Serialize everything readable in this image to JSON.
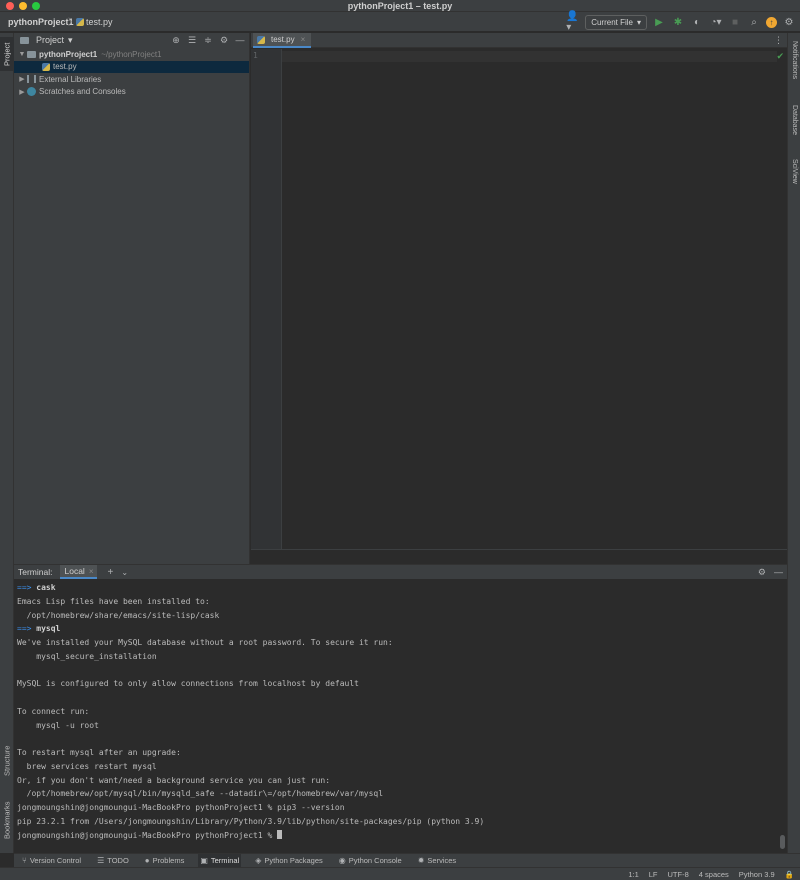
{
  "window": {
    "title": "pythonProject1 – test.py"
  },
  "navbar": {
    "project": "pythonProject1",
    "separator": "〉",
    "file": "test.py",
    "run_config": "Current File"
  },
  "left_stripe": {
    "project": "Project",
    "structure": "Structure",
    "bookmarks": "Bookmarks"
  },
  "right_stripe": {
    "notifications": "Notifications",
    "database": "Database",
    "sciview": "SciView"
  },
  "project_panel": {
    "title": "Project",
    "tree": {
      "root": {
        "name": "pythonProject1",
        "path": "~/pythonProject1"
      },
      "file": "test.py",
      "external": "External Libraries",
      "scratches": "Scratches and Consoles"
    }
  },
  "editor": {
    "tab": "test.py",
    "line_number": "1"
  },
  "terminal": {
    "title": "Terminal:",
    "tab": "Local",
    "lines": [
      {
        "type": "arrow",
        "arrow": "==>",
        "text": " cask"
      },
      {
        "type": "text",
        "text": "Emacs Lisp files have been installed to:"
      },
      {
        "type": "text",
        "text": "  /opt/homebrew/share/emacs/site-lisp/cask"
      },
      {
        "type": "arrow",
        "arrow": "==>",
        "text": " mysql"
      },
      {
        "type": "text",
        "text": "We've installed your MySQL database without a root password. To secure it run:"
      },
      {
        "type": "text",
        "text": "    mysql_secure_installation"
      },
      {
        "type": "text",
        "text": ""
      },
      {
        "type": "text",
        "text": "MySQL is configured to only allow connections from localhost by default"
      },
      {
        "type": "text",
        "text": ""
      },
      {
        "type": "text",
        "text": "To connect run:"
      },
      {
        "type": "text",
        "text": "    mysql -u root"
      },
      {
        "type": "text",
        "text": ""
      },
      {
        "type": "text",
        "text": "To restart mysql after an upgrade:"
      },
      {
        "type": "text",
        "text": "  brew services restart mysql"
      },
      {
        "type": "text",
        "text": "Or, if you don't want/need a background service you can just run:"
      },
      {
        "type": "text",
        "text": "  /opt/homebrew/opt/mysql/bin/mysqld_safe --datadir\\=/opt/homebrew/var/mysql"
      },
      {
        "type": "text",
        "text": "jongmoungshin@jongmoungui-MacBookPro pythonProject1 % pip3 --version"
      },
      {
        "type": "text",
        "text": "pip 23.2.1 from /Users/jongmoungshin/Library/Python/3.9/lib/python/site-packages/pip (python 3.9)"
      },
      {
        "type": "prompt",
        "text": "jongmoungshin@jongmoungui-MacBookPro pythonProject1 % "
      }
    ]
  },
  "tool_windows": [
    {
      "id": "version-control",
      "label": "Version Control",
      "icon": "branch-icon",
      "glyph": "⑂"
    },
    {
      "id": "todo",
      "label": "TODO",
      "icon": "list-icon",
      "glyph": "☰"
    },
    {
      "id": "problems",
      "label": "Problems",
      "icon": "info-icon",
      "glyph": "●"
    },
    {
      "id": "terminal",
      "label": "Terminal",
      "icon": "terminal-icon",
      "glyph": "▣",
      "active": true
    },
    {
      "id": "python-packages",
      "label": "Python Packages",
      "icon": "packages-icon",
      "glyph": "◈"
    },
    {
      "id": "python-console",
      "label": "Python Console",
      "icon": "console-icon",
      "glyph": "◉"
    },
    {
      "id": "services",
      "label": "Services",
      "icon": "services-icon",
      "glyph": "✹"
    }
  ],
  "status": {
    "position": "1:1",
    "line_ending": "LF",
    "encoding": "UTF-8",
    "indent": "4 spaces",
    "interpreter": "Python 3.9"
  },
  "colors": {
    "accent": "#4a88c7",
    "run": "#499c54",
    "update": "#f0a732"
  }
}
